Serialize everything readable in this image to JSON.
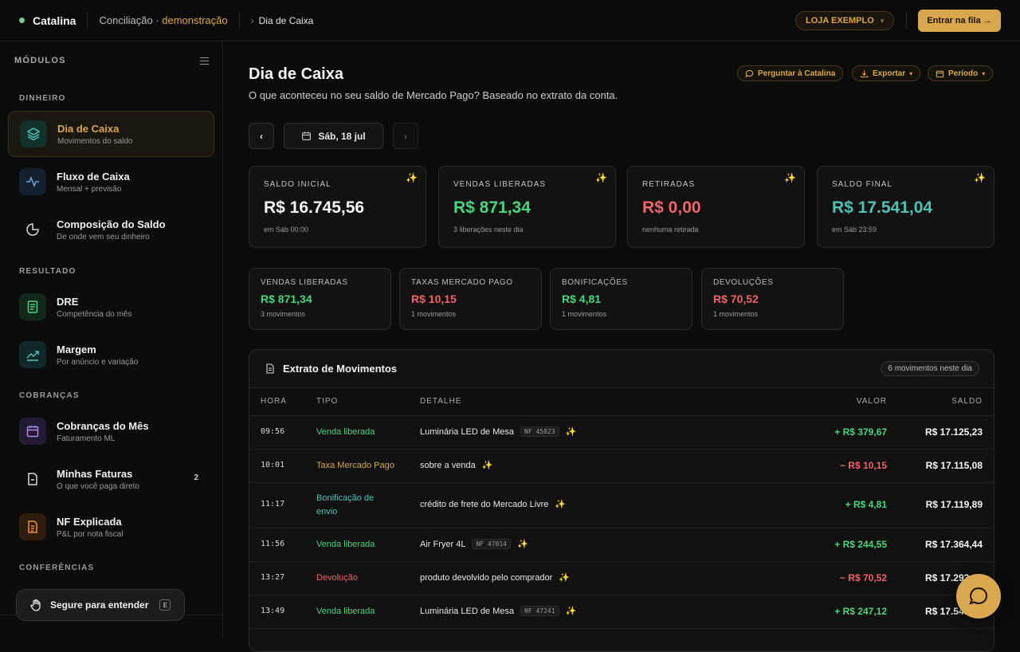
{
  "app": {
    "brand": "Catalina",
    "breadcrumb_main": "Conciliação · ",
    "breadcrumb_accent": "demonstração",
    "breadcrumb_page": "Dia de Caixa",
    "store_label": "LOJA EXEMPLO",
    "enter_button": "Entrar na fila →"
  },
  "sidebar": {
    "header": "MÓDULOS",
    "sections": {
      "dinheiro": "DINHEIRO",
      "resultado": "RESULTADO",
      "cobrancas": "COBRANÇAS",
      "conferencias": "CONFERÊNCIAS"
    },
    "items": [
      {
        "title": "Dia de Caixa",
        "subtitle": "Movimentos do saldo"
      },
      {
        "title": "Fluxo de Caixa",
        "subtitle": "Mensal + previsão"
      },
      {
        "title": "Composição do Saldo",
        "subtitle": "De onde vem seu dinheiro"
      },
      {
        "title": "DRE",
        "subtitle": "Competência do mês"
      },
      {
        "title": "Margem",
        "subtitle": "Por anúncio e variação"
      },
      {
        "title": "Cobranças do Mês",
        "subtitle": "Faturamento ML"
      },
      {
        "title": "Minhas Faturas",
        "subtitle": "O que você paga direto",
        "badge": "2"
      },
      {
        "title": "NF Explicada",
        "subtitle": "P&L por nota fiscal"
      }
    ],
    "hold_button": "Segure para entender",
    "hold_key": "E"
  },
  "page": {
    "title": "Dia de Caixa",
    "subtitle": "O que aconteceu no seu saldo de Mercado Pago? Baseado no extrato da conta.",
    "actions": {
      "ask": "Perguntar à Catalina",
      "export": "Exportar",
      "period": "Período"
    },
    "date_label": "Sáb, 18 jul",
    "prev_label": "‹",
    "next_label": "›"
  },
  "summary_cards": [
    {
      "label": "SALDO INICIAL",
      "value": "R$ 16.745,56",
      "foot": "em Sáb 00:00",
      "tone": "white"
    },
    {
      "label": "VENDAS LIBERADAS",
      "value": "R$ 871,34",
      "foot": "3 liberações neste dia",
      "tone": "pos"
    },
    {
      "label": "RETIRADAS",
      "value": "R$ 0,00",
      "foot": "nenhuma retirada",
      "tone": "neg"
    },
    {
      "label": "SALDO FINAL",
      "value": "R$ 17.541,04",
      "foot": "em Sáb 23:59",
      "tone": "tealc"
    }
  ],
  "mini_cards": [
    {
      "label": "VENDAS LIBERADAS",
      "value": "R$ 871,34",
      "foot": "3 movimentos",
      "tone": "pos"
    },
    {
      "label": "TAXAS MERCADO PAGO",
      "value": "R$ 10,15",
      "foot": "1 movimentos",
      "tone": "neg"
    },
    {
      "label": "BONIFICAÇÕES",
      "value": "R$ 4,81",
      "foot": "1 movimentos",
      "tone": "pos"
    },
    {
      "label": "DEVOLUÇÕES",
      "value": "R$ 70,52",
      "foot": "1 movimentos",
      "tone": "neg"
    }
  ],
  "ledger": {
    "title": "Extrato de Movimentos",
    "count": "6 movimentos neste dia",
    "columns": {
      "hora": "HORA",
      "tipo": "TIPO",
      "detalhe": "DETALHE",
      "valor": "VALOR",
      "saldo": "SALDO"
    },
    "rows": [
      {
        "hora": "09:56",
        "tipo": "Venda liberada",
        "detalhe": "Luminária LED de Mesa",
        "nf": "NF 45823",
        "valor": "+ R$ 379,67",
        "saldo": "R$ 17.125,23"
      },
      {
        "hora": "10:01",
        "tipo": "Taxa Mercado Pago",
        "detalhe": "sobre a venda",
        "nf": "",
        "valor": "− R$ 10,15",
        "saldo": "R$ 17.115,08"
      },
      {
        "hora": "11:17",
        "tipo": "Bonificação de envio",
        "detalhe": "crédito de frete do Mercado Livre",
        "nf": "",
        "valor": "+ R$ 4,81",
        "saldo": "R$ 17.119,89"
      },
      {
        "hora": "11:56",
        "tipo": "Venda liberada",
        "detalhe": "Air Fryer 4L",
        "nf": "NF 47014",
        "valor": "+ R$ 244,55",
        "saldo": "R$ 17.364,44"
      },
      {
        "hora": "13:27",
        "tipo": "Devolução",
        "detalhe": "produto devolvido pelo comprador",
        "nf": "",
        "valor": "− R$ 70,52",
        "saldo": "R$ 17.293,92"
      },
      {
        "hora": "13:49",
        "tipo": "Venda liberada",
        "detalhe": "Luminária LED de Mesa",
        "nf": "NF 47241",
        "valor": "+ R$ 247,12",
        "saldo": "R$ 17.541,04"
      }
    ]
  },
  "colors": {
    "accent": "#d9a84e",
    "positive": "#4ad67f",
    "negative": "#f0646a",
    "teal": "#4fc2b8"
  }
}
